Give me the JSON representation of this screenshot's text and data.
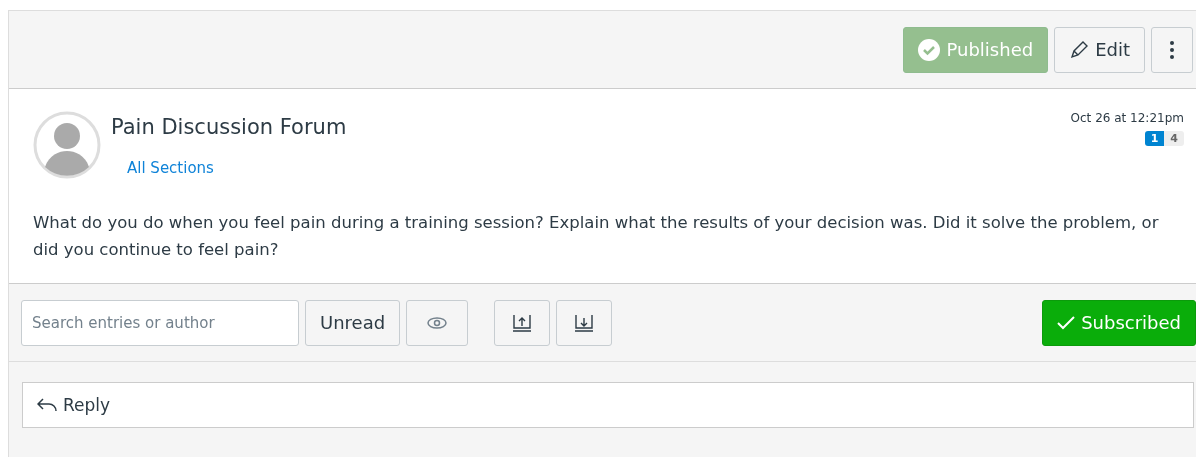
{
  "header": {
    "published": true,
    "publish_label": "Published",
    "edit_label": "Edit"
  },
  "topic": {
    "title": "Pain Discussion Forum",
    "sections": "All Sections",
    "date": "Oct 26 at 12:21pm",
    "unread_count": "1",
    "total_count": "4",
    "message": "What do you do when you feel pain during a training session? Explain what the results of your decision was. Did it solve the problem, or did you continue to feel pain?"
  },
  "toolbar": {
    "search": {
      "placeholder": "Search entries or author"
    },
    "unread_label": "Unread",
    "subscribed": true,
    "subscribe_label": "Subscribed"
  },
  "reply": {
    "label": "Reply"
  }
}
